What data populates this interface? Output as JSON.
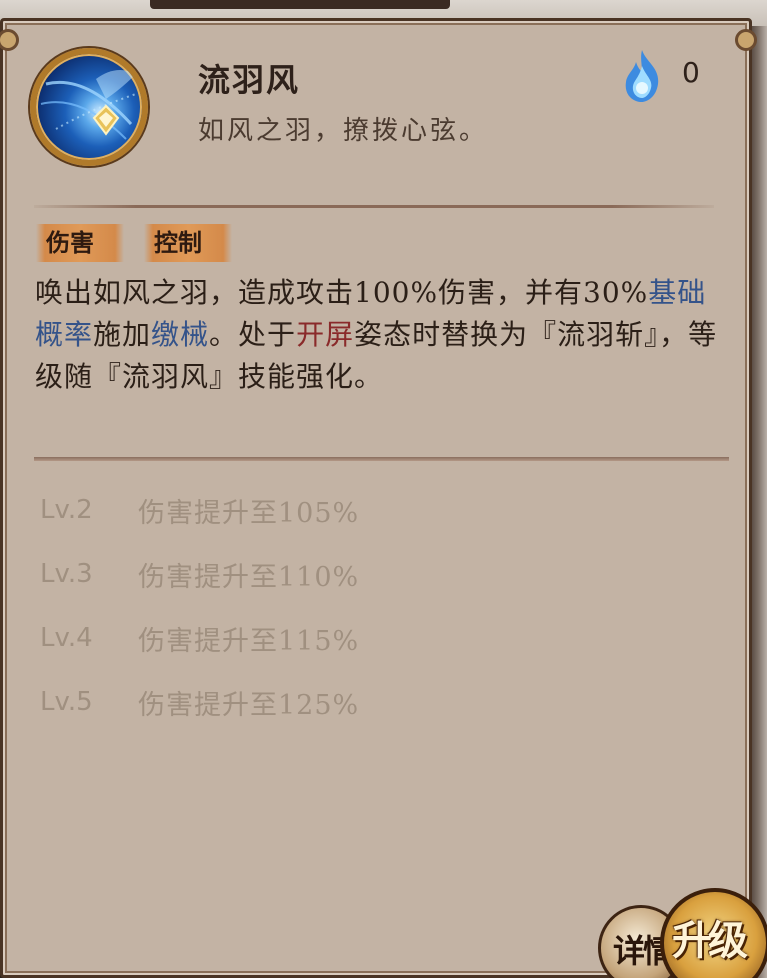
{
  "skill": {
    "name": "流羽风",
    "subtitle": "如风之羽，撩拨心弦。",
    "cost_value": "0",
    "icon": "feather-skill-icon",
    "cost_icon": "blue-spirit-flame-icon"
  },
  "tags": [
    "伤害",
    "控制"
  ],
  "description": {
    "part1": "唤出如风之羽，造成攻击100%伤害，并有30%",
    "keyword1": "基础概率",
    "part2": "施加",
    "keyword2": "缴械",
    "part3": "。处于",
    "keyword3": "开屏",
    "part4": "姿态时替换为『流羽斩』，等级随『流羽风』技能强化。"
  },
  "levels": [
    {
      "level": "Lv.2",
      "effect": "伤害提升至105%"
    },
    {
      "level": "Lv.3",
      "effect": "伤害提升至110%"
    },
    {
      "level": "Lv.4",
      "effect": "伤害提升至115%"
    },
    {
      "level": "Lv.5",
      "effect": "伤害提升至125%"
    }
  ],
  "buttons": {
    "detail": "详情",
    "upgrade": "升级"
  },
  "colors": {
    "keyword_blue": "#34538a",
    "keyword_red": "#8a2a2a",
    "panel_bg": "#c3b3a4",
    "tag_bg": "#e09a58"
  }
}
